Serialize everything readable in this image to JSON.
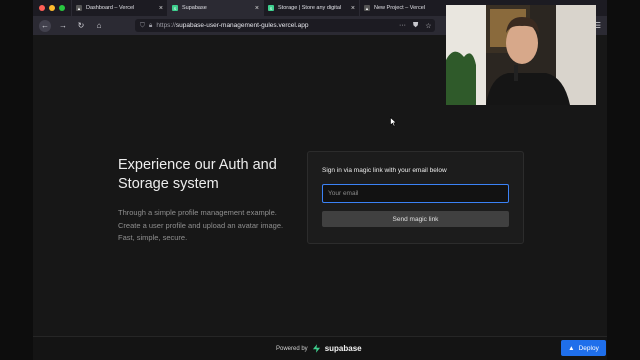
{
  "browser": {
    "tabs": [
      {
        "title": "Dashboard – Vercel",
        "favicon": "triangle-icon"
      },
      {
        "title": "Supabase",
        "favicon": "supabase-icon"
      },
      {
        "title": "Storage | Store any digital",
        "favicon": "supabase-icon"
      },
      {
        "title": "New Project – Vercel",
        "favicon": "triangle-icon"
      }
    ],
    "url_scheme": "https://",
    "url_host": "supabase-user-management-gules.vercel.app"
  },
  "hero": {
    "title": "Experience our Auth and Storage system",
    "description": "Through a simple profile management example. Create a user profile and upload an avatar image. Fast, simple, secure."
  },
  "signin": {
    "label": "Sign in via magic link with your email below",
    "email_placeholder": "Your email",
    "email_value": "",
    "button_label": "Send magic link"
  },
  "footer": {
    "powered_by": "Powered by",
    "brand": "supabase",
    "deploy_label": "Deploy"
  },
  "colors": {
    "accent_blue": "#1f6feb",
    "input_focus": "#3b82f6",
    "supabase_green": "#3ecf8e",
    "background": "#171717"
  }
}
